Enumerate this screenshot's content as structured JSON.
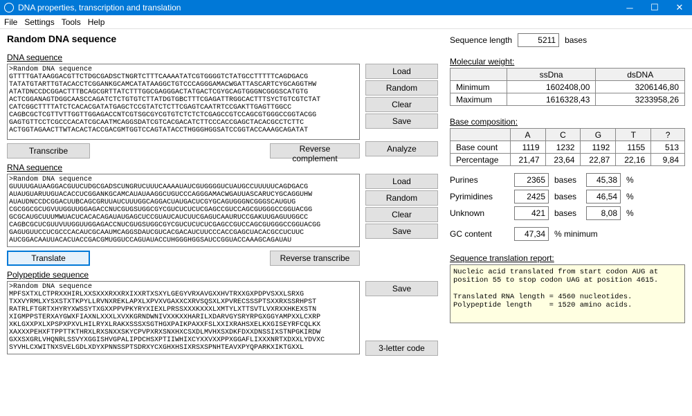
{
  "window": {
    "title": "DNA properties, transcription and translation"
  },
  "menu": {
    "file": "File",
    "settings": "Settings",
    "tools": "Tools",
    "help": "Help"
  },
  "main_heading": "Random DNA sequence",
  "seqlen": {
    "label": "Sequence length",
    "value": "5211",
    "unit": "bases"
  },
  "dna": {
    "header": "DNA sequence",
    "text": ">Random DNA sequence\nGTTTTGATAAGGACGTTCTDGCGADSCTNGRTCTTTCAAAATATCGTGGGGTCTATGCCTTTTTCAGDGACG\nTATATGTARTTGTACACCTCGGANKGCAMCATATAAGGCTGTCCCAGGGAMACWGATTASCARTCYGCAGGTHW\nATATDNCCDCGGACTTTBCAGCGRTTATCTTTGGCGAGGGACTATGACTCGYGCAGTGGGNCGGGSCATGTG\nACTCGGANAGTDGGCAASCCAGATCTCTGTGTCTTATDGTGBCTTTCGAGATTRGGCACTTTSYCTGTCGTCTAT\nCATCGGCTTTTATCTCACACGATATGAGCTCCGTATCTCTTCGAGTCAATRTCCGAKTTGAGTTGGCC\nCAGBCGCTCGTTVTTGGTTGGAGACCNTCGTSGCGYCGTGTCTCTCTCGAGCCGTCCAGCGTGGGCCGGTACGG\nGAGTGTTCCTCGCCCACATCGCAATMCAGGSDATCGTCACGACATCTTCCCACCGAGCTACACGCCTCTTC\nACTGGTAGAACTTWTACACTACCGACGMTGGTCCAGTATACCTHGGGHGGSATCCGGTACCAAAGCAGATAT",
    "transcribe": "Transcribe",
    "revcomp": "Reverse complement"
  },
  "rna": {
    "header": "RNA sequence",
    "text": ">Random DNA sequence\nGUUUUGAUAAGGACGUUCUDGCGADSCUNGRUCUUUCAAAAUAUCGUGGGGUCUAUGCCUUUUUCAGDGACG\nAUAUGUARUUGUACACCUCGGANKGCAMCAUAUAAGGCUGUCCCAGGGAMACWGAUUASCARUCYGCAGGUHW\nAUAUDNCCDCGGACUUBCAGCGRUUAUCUUUGGCAGGACUAUGACUCGYGCAGUGGGNCGGGSCAUGUG\nCGCGGCGCUGVUUGGUUGGAGACCNUCGUGSUGGCGYCGUCUCUCUCGAGCCGUCCAGCGUGGGCCGGUACGG\nGCGCAUGCUUUMWUACUCACACAGAUAUGAGCUCCGUAUCAUCUUCGAGUCAAURUCCGAKUUGAGUUGGCC\nCAGBCGCUCGUUVUUGGUUGGAGACCNUCGUGSUGGCGYCGUCUCUCUCGAGCCGUCCAGCGUGGGCCGGUACGG\nGAGUGUUCCUCGCCCACAUCGCAAUMCAGGSDAUCGUCACGACAUCUUCCCACCGAGCUACACGCCUCUUC\nAUCGGACAAUUACACUACCGACGMUGGUCCAGUAUACCUHGGGHGGSAUCCGGUACCAAAGCAGAUAU",
    "translate": "Translate",
    "revtrans": "Reverse transcribe"
  },
  "poly": {
    "header": "Polypeptide sequence",
    "text": ">Random DNA sequence\nMPFSXTXLCTPRXXHIRLXXSXXXRXXRXIXXRTXSXYLGEGYVRXAVGXXHVTRXXGXPDPVSXXLSRXG\nTXXVYRMLXYSXSTXTKPYLLRVNXREKLAPXLXPVXVGAXXCXRVSQSXLXPVRECSSSPTSXXRXSSRHPST\nRATRLFTGRTXHYRYXWSSYTXGXXPPVPKYRYXIEXLPRSSXXXKXXXLXMTYLXTTSVTLVXRXXHKEXSTN\nXIGMPPSTERXAYGWXFIAXNLXXXLXVXKGRNDWNIVXXKXXHARILXDARVGYSRYRPGXGGYAMPXXLCXRP\nXKLGXXPXLXPSPXPXVLHILRYXLRAKXSSSXSGTHGXPAIKPAXXFSLXXIXRAHSXELKXGISEYRFCQLKX\nXAXXXPEHXFTPPTTKTHRXLRXSNXXSKYCPVPXRXSNXHXCSXDLMVHXSXDKFDXXDNSSIXSTNPGKIRDW\nGXXSXGRLVHQNRLSSVYXGGISHVGPALIPDCHSXPTIIWHIXCYXXVXXPPXGGAFLIXXXNRTXDXXLYDVXC\nSYVHLCXWITNXSVELGDLXDYXPNNSSPTSDRXYCXGHXHSIXRSXSPNHTEAVXPYQPARKXIKTGXXL",
    "save": "Save",
    "three_letter": "3-letter code"
  },
  "buttons": {
    "load": "Load",
    "random": "Random",
    "clear": "Clear",
    "save": "Save",
    "analyze": "Analyze"
  },
  "mw": {
    "header": "Molecular weight:",
    "cols": [
      "ssDna",
      "dsDNA"
    ],
    "rows": [
      {
        "label": "Minimum",
        "ss": "1602408,00",
        "ds": "3206146,80"
      },
      {
        "label": "Maximum",
        "ss": "1616328,43",
        "ds": "3233958,26"
      }
    ]
  },
  "bc": {
    "header": "Base composition:",
    "cols": [
      "A",
      "C",
      "G",
      "T",
      "?"
    ],
    "rows": [
      {
        "label": "Base count",
        "v": [
          "1119",
          "1232",
          "1192",
          "1155",
          "513"
        ]
      },
      {
        "label": "Percentage",
        "v": [
          "21,47",
          "23,64",
          "22,87",
          "22,16",
          "9,84"
        ]
      }
    ]
  },
  "stats": {
    "purines": {
      "label": "Purines",
      "bases": "2365",
      "unit": "bases",
      "pct": "45,38",
      "pct_unit": "%"
    },
    "pyrimidines": {
      "label": "Pyrimidines",
      "bases": "2425",
      "unit": "bases",
      "pct": "46,54",
      "pct_unit": "%"
    },
    "unknown": {
      "label": "Unknown",
      "bases": "421",
      "unit": "bases",
      "pct": "8,08",
      "pct_unit": "%"
    },
    "gc": {
      "label": "GC content",
      "value": "47,34",
      "unit": "% minimum"
    }
  },
  "report": {
    "header": "Sequence translation report:",
    "text": "Nucleic acid translated from start codon AUG at position 55 to stop codon UAG at position 4615.\n\nTranslated RNA length = 4560 nucleotides.\nPolypeptide length    = 1520 amino acids."
  }
}
